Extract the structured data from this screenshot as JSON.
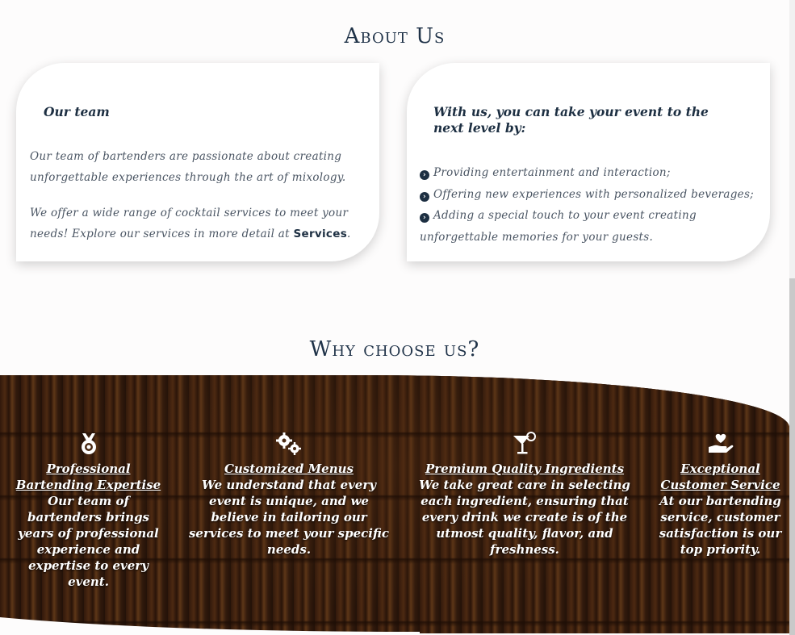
{
  "about": {
    "title": "About Us",
    "team_card": {
      "heading": "Our team",
      "para1": "Our team of bartenders are passionate about creating unforgettable experiences through the art of mixology.",
      "para2_prefix": "We offer a wide range of cocktail services to meet your needs! Explore our services in more detail at ",
      "para2_link": "Services",
      "para2_suffix": "."
    },
    "event_card": {
      "heading": "With us, you can take your event to the next level by:",
      "items": [
        "Providing entertainment and interaction;",
        "Offering new experiences with personalized beverages;",
        "Adding a special touch to your event creating unforgettable memories for your guests."
      ]
    }
  },
  "why": {
    "title": "Why choose us?",
    "features": [
      {
        "icon": "medal-icon",
        "title": "Professional Bartending Expertise",
        "text": "Our team of bartenders brings years of professional experience and expertise to every event."
      },
      {
        "icon": "gears-icon",
        "title": "Customized Menus",
        "text": "We understand that every event is unique, and we believe in tailoring our services to meet your specific needs."
      },
      {
        "icon": "cocktail-icon",
        "title": "Premium Quality Ingredients",
        "text": "We take great care in selecting each ingredient, ensuring that every drink we create is of the utmost quality, flavor, and freshness."
      },
      {
        "icon": "hand-heart-icon",
        "title": "Exceptional Customer Service",
        "text": "At our bartending service, customer satisfaction is our top priority."
      }
    ]
  },
  "colors": {
    "heading": "#1f3248",
    "body_text": "#4a5563",
    "background": "#fdfcfc"
  }
}
